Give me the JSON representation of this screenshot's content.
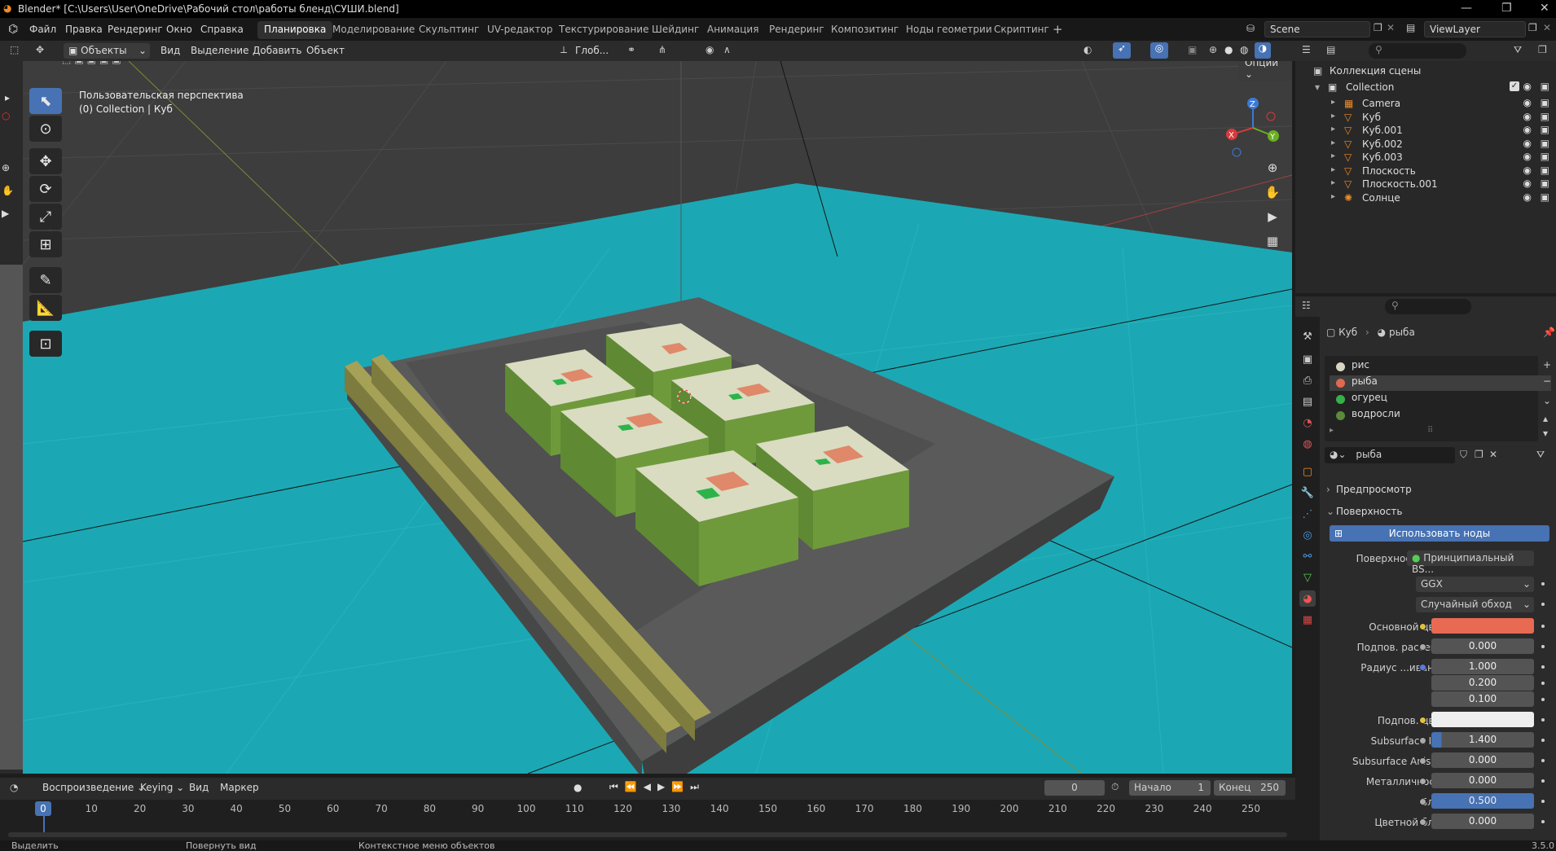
{
  "window": {
    "title": "Blender* [C:\\Users\\User\\OneDrive\\Рабочий стол\\работы бленд\\СУШИ.blend]"
  },
  "menu": [
    "Файл",
    "Правка",
    "Рендеринг",
    "Окно",
    "Справка"
  ],
  "workspaces": [
    "Планировка",
    "Моделирование",
    "Скульптинг",
    "UV-редактор",
    "Текстурирование",
    "Шейдинг",
    "Анимация",
    "Рендеринг",
    "Композитинг",
    "Ноды геометрии",
    "Скриптинг"
  ],
  "active_workspace": "Планировка",
  "scene": {
    "name": "Scene",
    "view_layer": "ViewLayer"
  },
  "viewport_header": {
    "mode": "Объекты",
    "menus": [
      "Вид",
      "Выделение",
      "Добавить",
      "Объект"
    ],
    "orientation": "Глоб...",
    "options": "Опции"
  },
  "viewport": {
    "view_name": "Пользовательская перспектива",
    "collection_info": "(0) Collection | Куб",
    "colors": {
      "floor": "#1ba8b4",
      "board": "#5a5a5a",
      "roll_side": "#6f9a3c",
      "roll_top": "#d9dcc0",
      "fish": "#e0886a",
      "cucumber": "#2db34a",
      "chopsticks": "#9c9a4e"
    }
  },
  "outliner": {
    "root": "Коллекция сцены",
    "collection": "Collection",
    "objects": [
      {
        "name": "Camera",
        "icon": "camera-icon"
      },
      {
        "name": "Куб",
        "icon": "mesh-icon"
      },
      {
        "name": "Куб.001",
        "icon": "mesh-icon"
      },
      {
        "name": "Куб.002",
        "icon": "mesh-icon"
      },
      {
        "name": "Куб.003",
        "icon": "mesh-icon"
      },
      {
        "name": "Плоскость",
        "icon": "mesh-icon"
      },
      {
        "name": "Плоскость.001",
        "icon": "mesh-icon"
      },
      {
        "name": "Солнце",
        "icon": "sun-icon"
      }
    ]
  },
  "properties": {
    "breadcrumb": {
      "object": "Куб",
      "material": "рыба"
    },
    "materials": [
      {
        "name": "рис",
        "color": "#d8d6c2"
      },
      {
        "name": "рыба",
        "color": "#e06a50"
      },
      {
        "name": "огурец",
        "color": "#35b04a"
      },
      {
        "name": "водросли",
        "color": "#5c8a3a"
      }
    ],
    "selected_material": "рыба",
    "material_field": "рыба",
    "sections": {
      "preview": "Предпросмотр",
      "surface": "Поверхность"
    },
    "use_nodes": "Использовать ноды",
    "surface_label": "Поверхность",
    "surface_value": "Принципиальный BS...",
    "distribution": "GGX",
    "subsurface_method": "Случайный обход",
    "rows": [
      {
        "label": "Основной цвет",
        "value": "",
        "color": "#e86a52"
      },
      {
        "label": "Подпов. рассеи...",
        "value": "0.000"
      },
      {
        "label": "Радиус ...ивания",
        "value": "1.000"
      },
      {
        "label": "",
        "value": "0.200"
      },
      {
        "label": "",
        "value": "0.100"
      },
      {
        "label": "Подпов. цвет",
        "value": "",
        "color": "#eeeeee"
      },
      {
        "label": "Subsurface IOR",
        "value": "1.400"
      },
      {
        "label": "Subsurface Aniso...",
        "value": "0.000"
      },
      {
        "label": "Металличность",
        "value": "0.000"
      },
      {
        "label": "Блик",
        "value": "0.500"
      },
      {
        "label": "Цветной блик",
        "value": "0.000"
      }
    ]
  },
  "timeline": {
    "menus": [
      "Воспроизведение",
      "Keying",
      "Вид",
      "Маркер"
    ],
    "current_frame": "0",
    "start_label": "Начало",
    "start": "1",
    "end_label": "Конец",
    "end": "250",
    "ticks": [
      "0",
      "10",
      "20",
      "30",
      "40",
      "50",
      "60",
      "70",
      "80",
      "90",
      "100",
      "110",
      "120",
      "130",
      "140",
      "150",
      "160",
      "170",
      "180",
      "190",
      "200",
      "210",
      "220",
      "230",
      "240",
      "250"
    ]
  },
  "statusbar": {
    "items": [
      "Выделить",
      "Повернуть вид",
      "Контекстное меню объектов"
    ],
    "version": "3.5.0"
  }
}
